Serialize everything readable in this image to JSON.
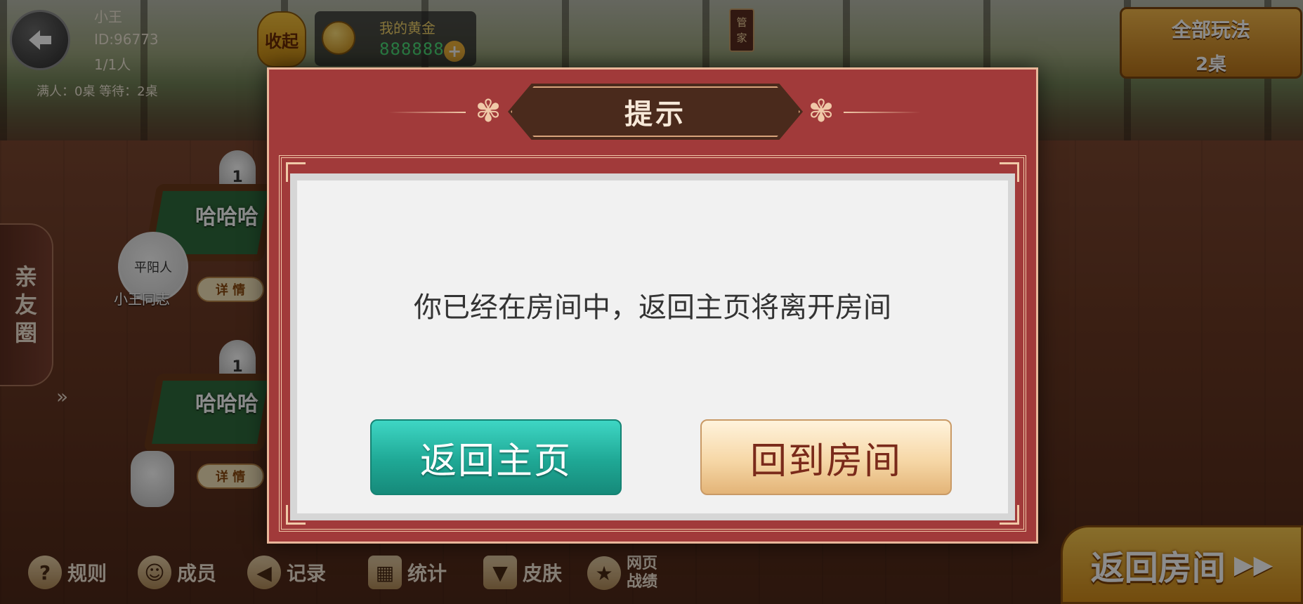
{
  "header": {
    "user_name": "小王",
    "user_id": "ID:96773",
    "member_count": "1/1人",
    "table_stats": "满人：0桌  等待：2桌",
    "collapse_label": "收起",
    "gold_label": "我的黄金",
    "gold_value": "888888",
    "manager_label": "管家",
    "all_modes_label": "全部玩法",
    "all_modes_count": "2桌"
  },
  "side": {
    "friend_circle_label": "亲友圈",
    "expand_glyph": "»"
  },
  "tables": [
    {
      "title": "哈哈哈",
      "seat": "1",
      "detail": "详 情",
      "player_name": "小王同志",
      "avatar_text": "平阳人"
    },
    {
      "title": "哈哈哈",
      "seat": "1",
      "detail": "详 情"
    }
  ],
  "toolbar": {
    "rules": "规则",
    "members": "成员",
    "records": "记录",
    "stats": "统计",
    "skins": "皮肤",
    "web_record_line1": "网页",
    "web_record_line2": "战绩",
    "return_room": "返回房间",
    "return_room_glyph": "▶▶"
  },
  "dialog": {
    "title": "提示",
    "message": "你已经在房间中，返回主页将离开房间",
    "home_button": "返回主页",
    "room_button": "回到房间"
  },
  "colors": {
    "dialog_red": "#a13a3a",
    "home_button": "#1fa895",
    "room_button": "#f6d7a6",
    "gold_green": "#4ee07a"
  }
}
